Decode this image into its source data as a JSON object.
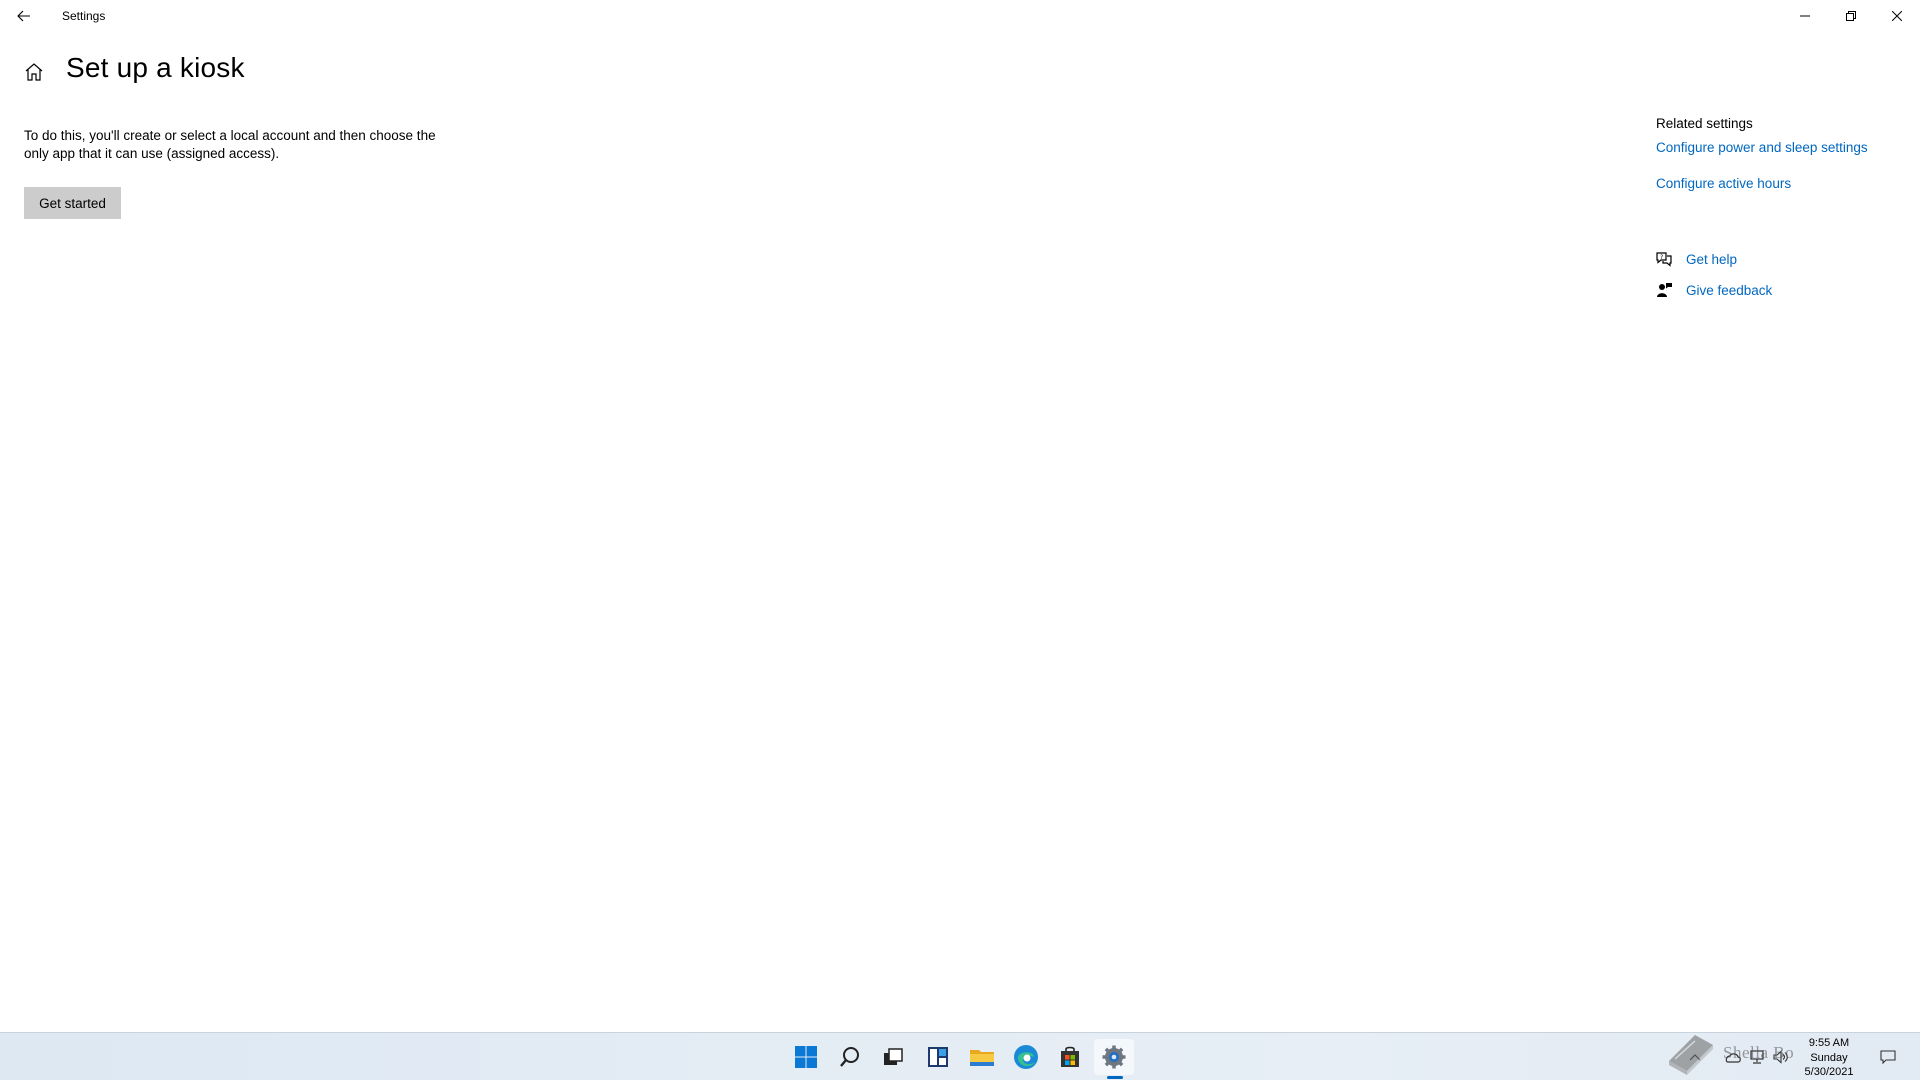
{
  "window": {
    "title": "Settings",
    "back_icon": "arrow-left-icon",
    "min_icon": "minimize-icon",
    "max_icon": "restore-icon",
    "close_icon": "close-icon"
  },
  "page": {
    "title": "Set up a kiosk",
    "home_icon": "home-icon",
    "description": "To do this, you'll create or select a local account and then choose the only app that it can use (assigned access).",
    "get_started_label": "Get started"
  },
  "related": {
    "title": "Related settings",
    "links": [
      "Configure power and sleep settings",
      "Configure active hours"
    ],
    "get_help": "Get help",
    "give_feedback": "Give feedback"
  },
  "taskbar": {
    "icons": [
      "start-icon",
      "search-icon",
      "task-view-icon",
      "widgets-icon",
      "file-explorer-icon",
      "edge-icon",
      "store-icon",
      "settings-icon"
    ],
    "active": "settings-icon",
    "time": "9:55 AM",
    "day": "Sunday",
    "date": "5/30/2021",
    "watermark": "Shella Bo"
  },
  "colors": {
    "accent": "#0067c0",
    "button_bg": "#cccccc"
  }
}
